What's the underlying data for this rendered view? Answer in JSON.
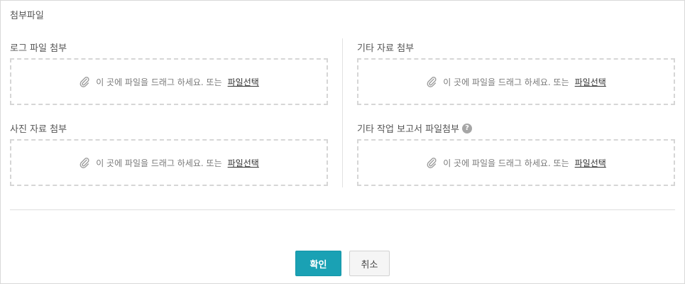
{
  "section": {
    "title": "첨부파일"
  },
  "dropzone_text": "이 곳에 파일을 드래그 하세요. 또는",
  "dropzone_link": "파일선택",
  "fields": {
    "log": {
      "label": "로그 파일 첨부"
    },
    "other": {
      "label": "기타 자료 첨부"
    },
    "photo": {
      "label": "사진 자료 첨부"
    },
    "report": {
      "label": "기타 작업 보고서 파일첨부",
      "help": "?"
    }
  },
  "buttons": {
    "confirm": "확인",
    "cancel": "취소"
  },
  "colors": {
    "accent": "#1aa1b4",
    "border": "#d9d9d9",
    "dashed": "#d6d6d6"
  }
}
